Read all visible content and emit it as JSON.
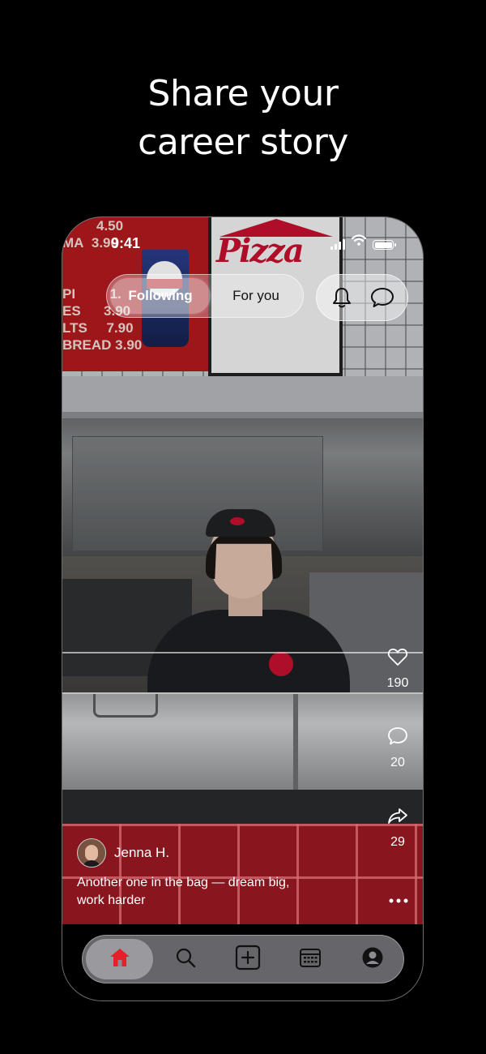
{
  "headline": {
    "line1": "Share your",
    "line2": "career story"
  },
  "status_bar": {
    "time": "9:41"
  },
  "feed_tabs": [
    {
      "label": "Following",
      "active": true
    },
    {
      "label": "For you",
      "active": false
    }
  ],
  "top_actions": [
    {
      "icon": "bell-icon"
    },
    {
      "icon": "chat-bubble-icon"
    }
  ],
  "post": {
    "author": "Jenna H.",
    "caption": "Another one in the bag — dream big, work harder",
    "likes": "190",
    "comments": "20",
    "shares": "29"
  },
  "bottom_nav": [
    {
      "icon": "home-icon",
      "active": true,
      "color": "#e5202a"
    },
    {
      "icon": "search-icon",
      "active": false
    },
    {
      "icon": "add-post-icon",
      "active": false
    },
    {
      "icon": "calendar-icon",
      "active": false
    },
    {
      "icon": "profile-icon",
      "active": false
    }
  ],
  "colors": {
    "background": "#000000",
    "accent": "#e5202a",
    "brand_red": "#c8102e"
  }
}
